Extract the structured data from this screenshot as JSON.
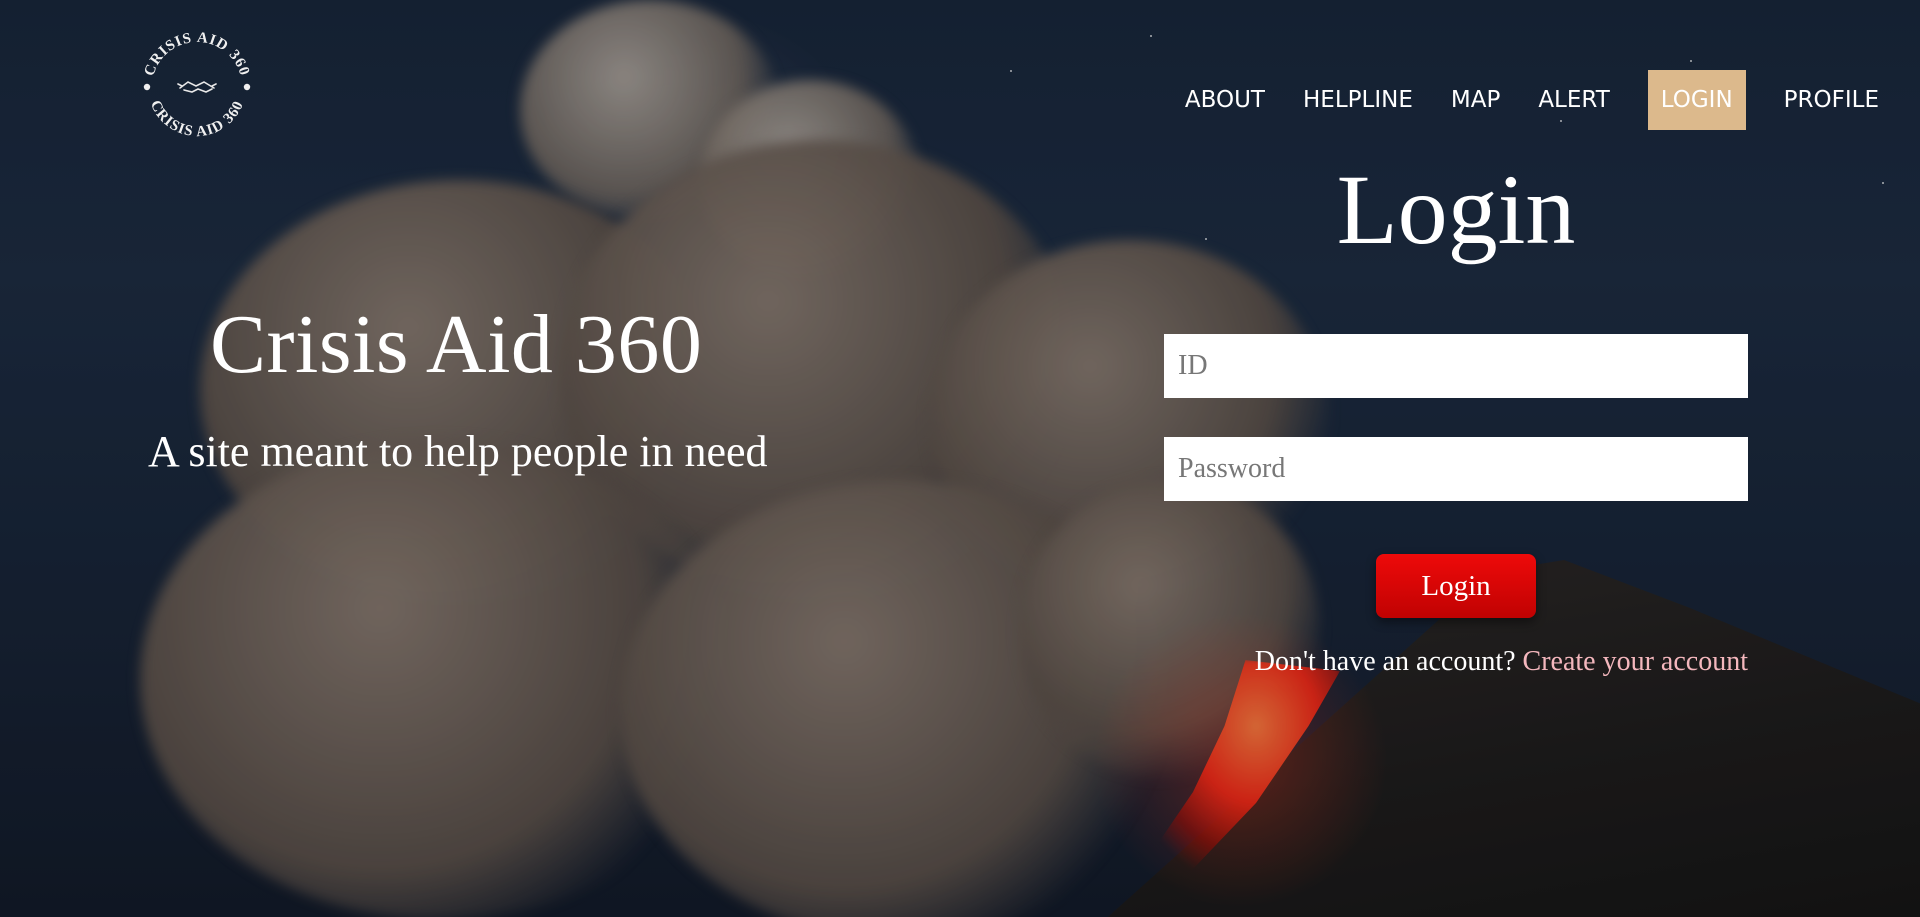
{
  "logo": {
    "text_top": "CRISIS AID 360",
    "text_bottom": "CRISIS AID 360",
    "icon": "handshake-icon"
  },
  "nav": {
    "items": [
      {
        "label": "ABOUT"
      },
      {
        "label": "HELPLINE"
      },
      {
        "label": "MAP"
      },
      {
        "label": "ALERT"
      },
      {
        "label": "LOGIN",
        "active": true
      },
      {
        "label": "PROFILE"
      }
    ],
    "active_color": "#dcb98c"
  },
  "hero": {
    "title": "Crisis Aid 360",
    "subtitle": "A site meant to help people in need"
  },
  "login": {
    "heading": "Login",
    "id_placeholder": "ID",
    "password_placeholder": "Password",
    "button_label": "Login",
    "button_color": "#e00707",
    "signup_prompt": "Don't have an account?",
    "signup_link": "Create your account",
    "link_color": "#f4b7bd"
  }
}
